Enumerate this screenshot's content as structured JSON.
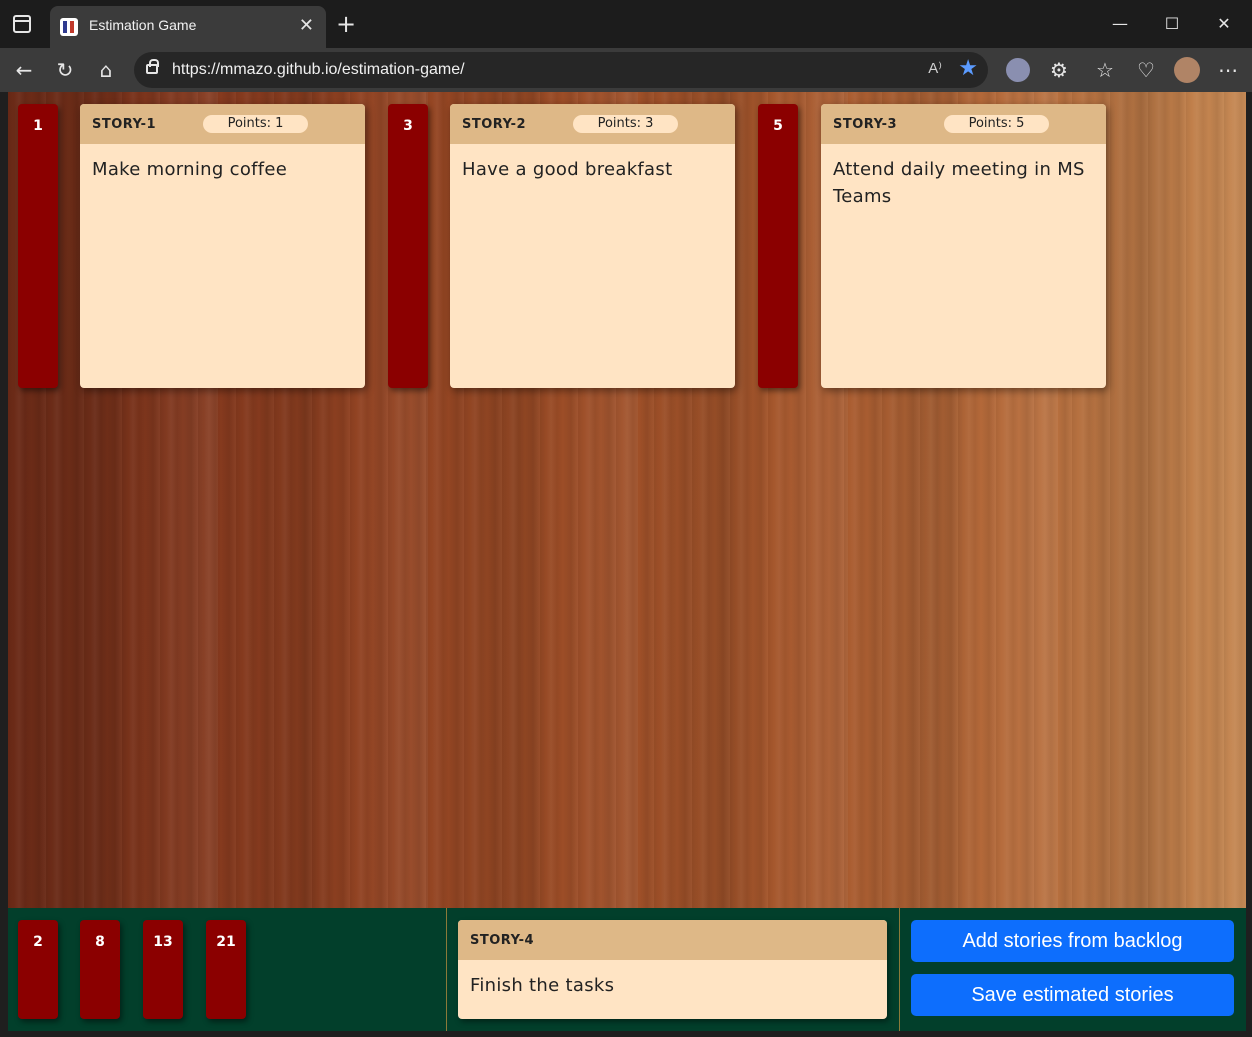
{
  "browser": {
    "tab_title": "Estimation Game",
    "tab_close": "✕",
    "new_tab": "+",
    "url": "https://mmazo.github.io/estimation-game/",
    "read_aloud": "A⁾",
    "window_controls": {
      "minimize": "—",
      "maximize": "☐",
      "close": "✕"
    },
    "toolbar_icons": [
      "back-icon",
      "refresh-icon",
      "home-icon",
      "lock-icon",
      "read-aloud-icon",
      "star-icon",
      "profile-icon",
      "extensions-icon",
      "favorites-icon",
      "health-icon",
      "avatar",
      "more-icon"
    ],
    "glyphs": {
      "back": "←",
      "refresh": "↻",
      "home": "⌂",
      "star": "★",
      "extensions": "⚙",
      "favorites": "☆",
      "health": "♡",
      "more": "⋯"
    }
  },
  "board": {
    "columns": [
      {
        "estimate": "1",
        "story_id": "STORY-1",
        "points_label": "Points: 1",
        "description": "Make morning coffee"
      },
      {
        "estimate": "3",
        "story_id": "STORY-2",
        "points_label": "Points: 3",
        "description": "Have a good breakfast"
      },
      {
        "estimate": "5",
        "story_id": "STORY-3",
        "points_label": "Points: 5",
        "description": "Attend daily meeting in MS Teams"
      }
    ]
  },
  "tray": {
    "available_estimates": [
      "2",
      "8",
      "13",
      "21"
    ],
    "current_story": {
      "story_id": "STORY-4",
      "description": "Finish the tasks"
    },
    "buttons": {
      "add_backlog": "Add stories from backlog",
      "save_estimated": "Save estimated stories"
    }
  },
  "colors": {
    "estimate_tag": "#8b0000",
    "card_body": "#ffe4c4",
    "card_header": "#deb887",
    "tray_bg": "#023f2b",
    "button_primary": "#0d6efd"
  }
}
